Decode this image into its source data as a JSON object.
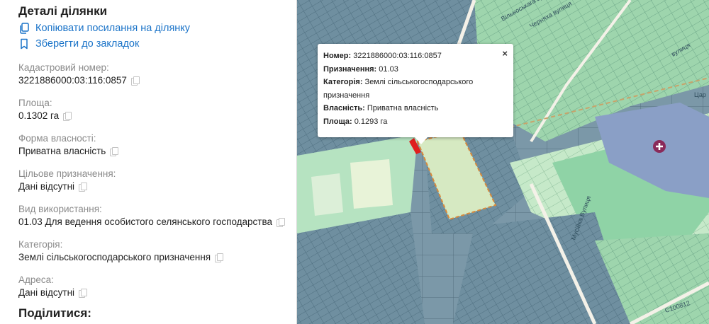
{
  "details": {
    "title": "Деталі ділянки",
    "copy_link": "Копіювати посилання на ділянку",
    "save_bookmark": "Зберегти до закладок",
    "fields": [
      {
        "label": "Кадастровий номер:",
        "value": "3221886000:03:116:0857"
      },
      {
        "label": "Площа:",
        "value": "0.1302 га"
      },
      {
        "label": "Форма власності:",
        "value": "Приватна власність"
      },
      {
        "label": "Цільове призначення:",
        "value": "Дані відсутні"
      },
      {
        "label": "Вид використання:",
        "value": "01.03 Для ведення особистого селянського господарства"
      },
      {
        "label": "Категорія:",
        "value": "Землі сільськогосподарського призначення"
      },
      {
        "label": "Адреса:",
        "value": "Дані відсутні"
      }
    ],
    "share_title": "Поділитися:"
  },
  "popup": {
    "close": "×",
    "rows": [
      {
        "key": "Номер:",
        "value": "3221886000:03:116:0857"
      },
      {
        "key": "Призначення:",
        "value": "01.03"
      },
      {
        "key": "Категорія:",
        "value": "Землі сільськогосподарського"
      },
      {
        "key": "",
        "value": "призначення"
      },
      {
        "key": "Власність:",
        "value": "Приватна власність"
      },
      {
        "key": "Площа:",
        "value": "0.1293 га"
      }
    ]
  },
  "map_labels": {
    "street_1": "Мусійка Вулиця",
    "road": "С100812",
    "street_2": "Черняха вулиця",
    "street_3": "вулиця",
    "street_4": "Вільноськага вулиця",
    "edge": "Цар"
  },
  "colors": {
    "link": "#1a73c8",
    "parcel_blue": "#6f8fa0",
    "parcel_green": "#a5dcb0",
    "highlight": "#d7e8bf",
    "selected": "#e0201e"
  }
}
